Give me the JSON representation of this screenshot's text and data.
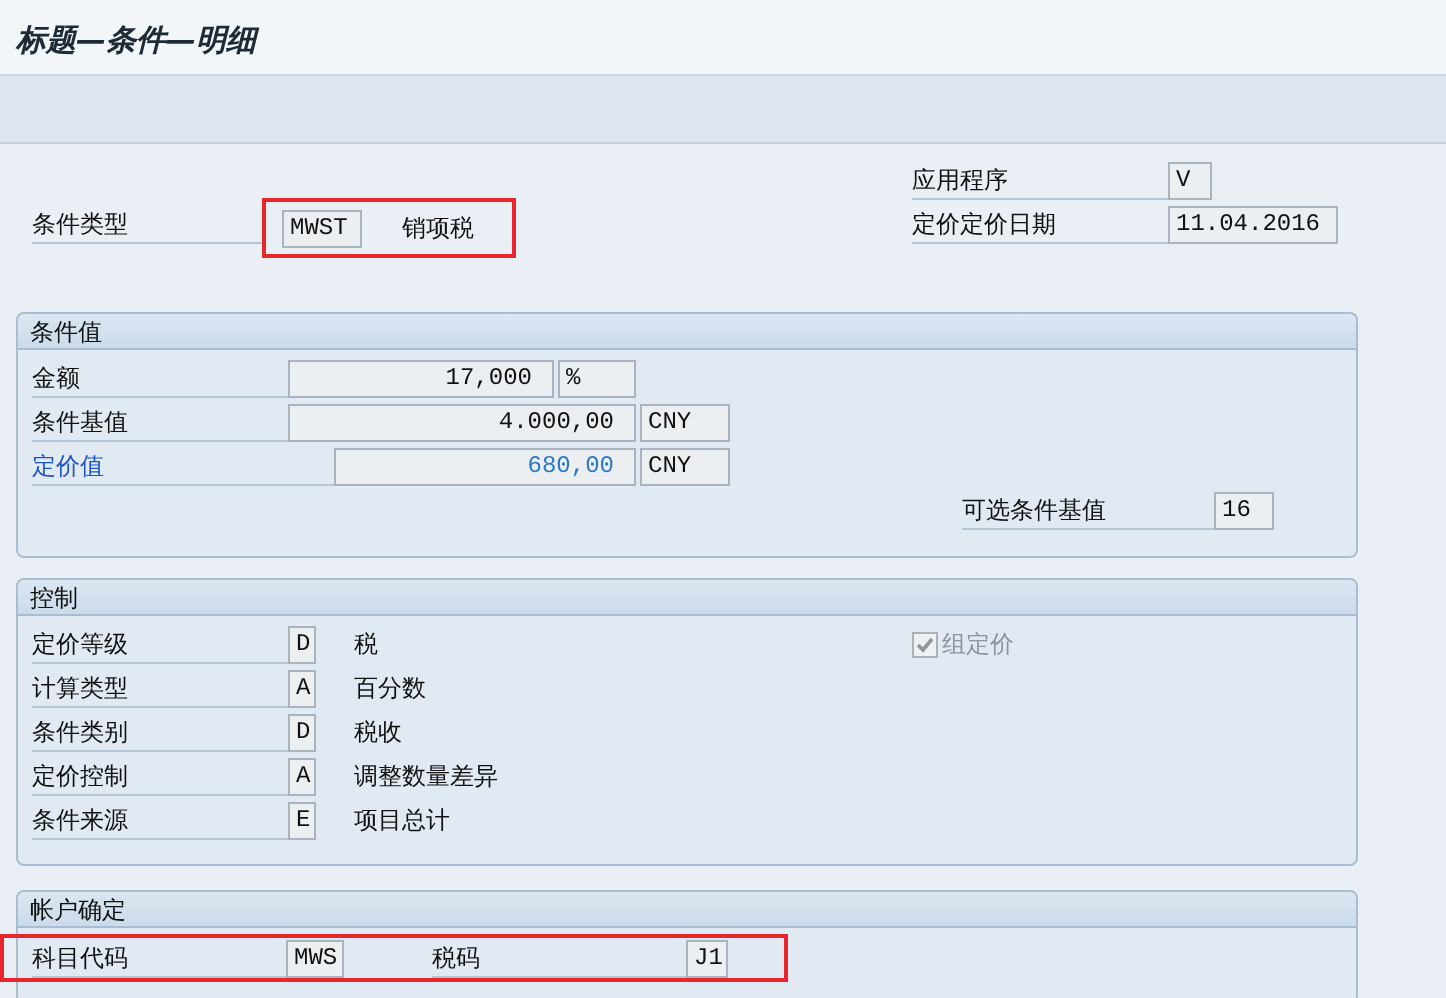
{
  "window": {
    "title": "标题—条件—明细"
  },
  "application": {
    "label": "应用程序",
    "value": "V"
  },
  "condition_type": {
    "label": "条件类型",
    "code": "MWST",
    "description": "销项税",
    "highlighted": true
  },
  "pricing_date": {
    "label": "定价定价日期",
    "value": "11.04.2016"
  },
  "groups": [
    {
      "kind": "values",
      "title": "条件值",
      "rows": [
        {
          "label": "金额",
          "value": "17,000",
          "unit": "%",
          "emphasized": false
        },
        {
          "label": "条件基值",
          "value": "4.000,00",
          "unit": "CNY",
          "emphasized": false
        },
        {
          "label": "定价值",
          "value": "680,00",
          "unit": "CNY",
          "emphasized": true
        }
      ],
      "alt_base": {
        "label": "可选条件基值",
        "value": "16"
      }
    },
    {
      "kind": "control",
      "title": "控制",
      "rows": [
        {
          "label": "定价等级",
          "code": "D",
          "description": "税"
        },
        {
          "label": "计算类型",
          "code": "A",
          "description": "百分数"
        },
        {
          "label": "条件类别",
          "code": "D",
          "description": "税收"
        },
        {
          "label": "定价控制",
          "code": "A",
          "description": "调整数量差异"
        },
        {
          "label": "条件来源",
          "code": "E",
          "description": "项目总计"
        }
      ],
      "checkbox": {
        "label": "组定价",
        "checked": true,
        "disabled": true
      }
    },
    {
      "kind": "account",
      "title": "帐户确定",
      "highlighted": true,
      "fields": [
        {
          "label": "科目代码",
          "value": "MWS"
        },
        {
          "label": "税码",
          "value": "J1"
        }
      ]
    }
  ]
}
